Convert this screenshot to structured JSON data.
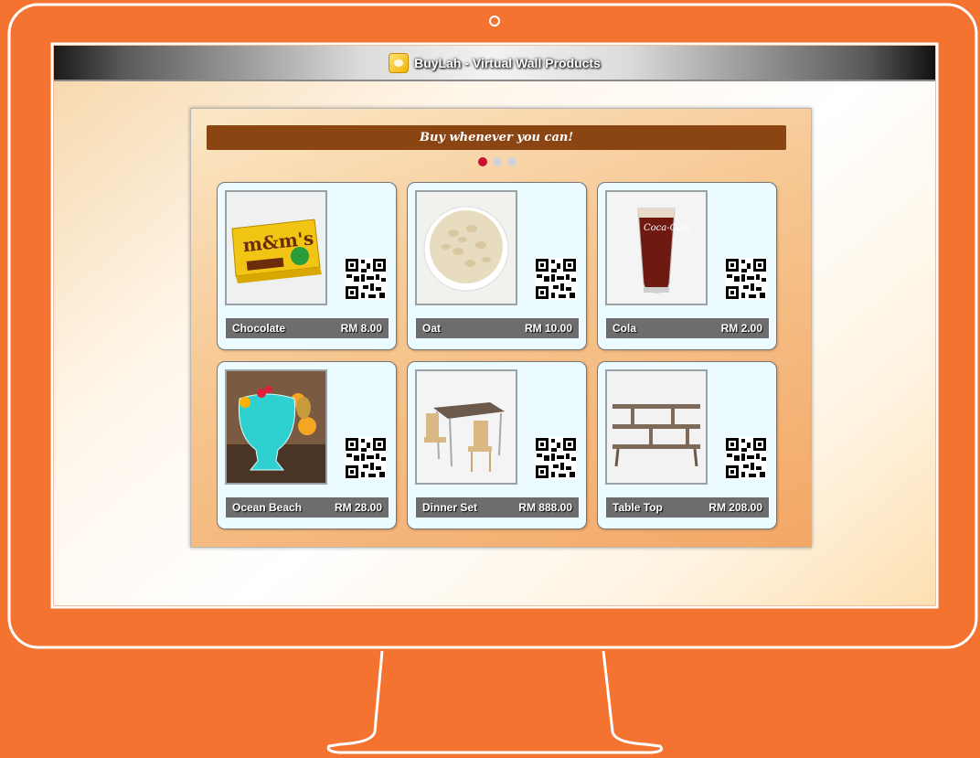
{
  "window": {
    "title": "BuyLah - Virtual Wall Products"
  },
  "banner": {
    "text": "Buy whenever you can!"
  },
  "carousel": {
    "pages": 3,
    "active": 1
  },
  "colors": {
    "frame": "#f47330",
    "banner": "#8b4513",
    "active_dot": "#c8102e"
  },
  "products": [
    {
      "name": "Chocolate",
      "price": "RM 8.00",
      "image": "mm-chocolate-box"
    },
    {
      "name": "Oat",
      "price": "RM 10.00",
      "image": "oat-bowl"
    },
    {
      "name": "Cola",
      "price": "RM 2.00",
      "image": "cola-glass"
    },
    {
      "name": "Ocean Beach",
      "price": "RM 28.00",
      "image": "blue-cocktail"
    },
    {
      "name": "Dinner Set",
      "price": "RM 888.00",
      "image": "dining-table-set"
    },
    {
      "name": "Table Top",
      "price": "RM 208.00",
      "image": "wooden-shelf"
    }
  ]
}
